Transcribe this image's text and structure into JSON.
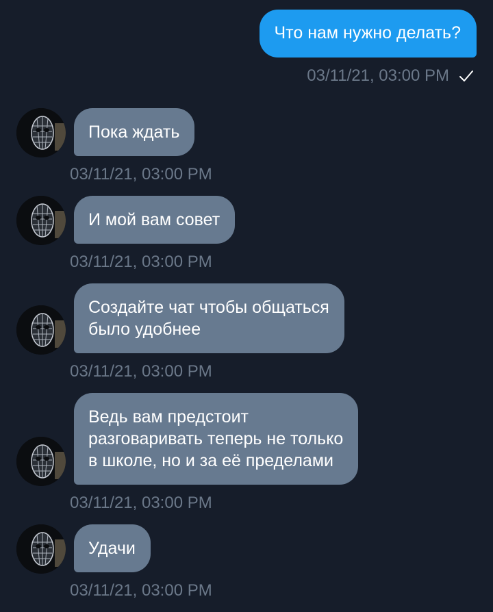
{
  "outgoing": {
    "text": "Что нам нужно делать?",
    "time": "03/11/21, 03:00 PM",
    "read_icon": "check-icon"
  },
  "incoming": [
    {
      "lines": [
        "Пока ждать"
      ],
      "time": "03/11/21, 03:00 PM"
    },
    {
      "lines": [
        "И мой вам совет"
      ],
      "time": "03/11/21, 03:00 PM"
    },
    {
      "lines": [
        "Создайте чат чтобы общаться",
        "было удобнее"
      ],
      "time": "03/11/21, 03:00 PM"
    },
    {
      "lines": [
        "Ведь вам предстоит",
        "разговаривать теперь не только",
        "в школе, но и за её пределами"
      ],
      "time": "03/11/21, 03:00 PM"
    },
    {
      "lines": [
        "Удачи"
      ],
      "time": "03/11/21, 03:00 PM"
    }
  ],
  "colors": {
    "background": "#161d2a",
    "outgoing_bubble": "#1d9bf0",
    "incoming_bubble": "#677a90",
    "timestamp": "#6b7889"
  }
}
